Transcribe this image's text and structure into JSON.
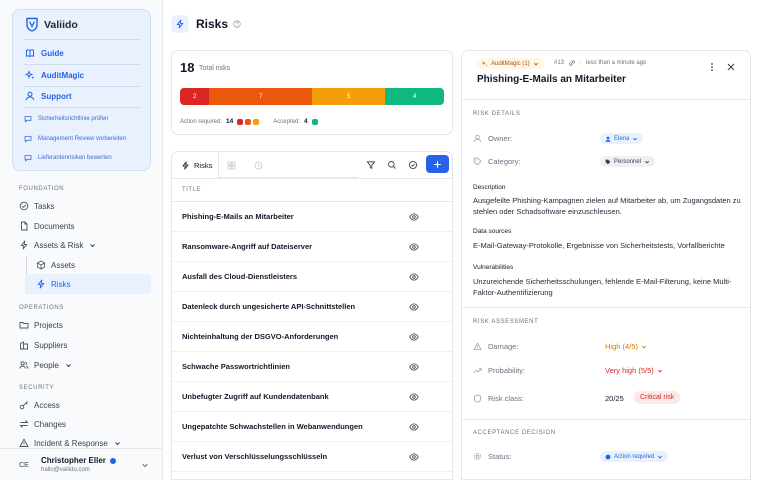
{
  "app": {
    "name": "Valiido"
  },
  "sidebar": {
    "primary": [
      {
        "label": "Guide",
        "icon": "guide-book-icon"
      },
      {
        "label": "AuditMagic",
        "icon": "sparkles-icon"
      },
      {
        "label": "Support",
        "icon": "user-support-icon"
      }
    ],
    "tasks": [
      "Sicherheitsrichtlinie prüfen",
      "Management Review vorbereiten",
      "Lieferantenrisiken bewerten"
    ],
    "sections": {
      "foundation": "FOUNDATION",
      "operations": "OPERATIONS",
      "security": "SECURITY"
    },
    "nav": {
      "tasks": "Tasks",
      "documents": "Documents",
      "assets_risk": "Assets & Risk",
      "assets": "Assets",
      "risks": "Risks",
      "projects": "Projects",
      "suppliers": "Suppliers",
      "people": "People",
      "access": "Access",
      "changes": "Changes",
      "incident_response": "Incident & Response"
    },
    "user": {
      "initials": "CE",
      "name": "Christopher Eller",
      "email": "hallo@valiido.com"
    }
  },
  "header": {
    "title": "Risks"
  },
  "summary": {
    "total": "18",
    "total_label": "Total risks",
    "segments": [
      {
        "value": 2,
        "color": "#dc2626"
      },
      {
        "value": 7,
        "color": "#ea580c"
      },
      {
        "value": 5,
        "color": "#f59e0b"
      },
      {
        "value": 4,
        "color": "#10b981"
      }
    ],
    "action_required_label": "Action required:",
    "action_required_count": "14",
    "accepted_label": "Accepted:",
    "accepted_count": "4"
  },
  "table": {
    "tab_label": "Risks",
    "column_title": "TITLE",
    "rows": [
      "Phishing-E-Mails an Mitarbeiter",
      "Ransomware-Angriff auf Dateiserver",
      "Ausfall des Cloud-Dienstleisters",
      "Datenleck durch ungesicherte API-Schnittstellen",
      "Nichteinhaltung der DSGVO-Anforderungen",
      "Schwache Passwortrichtlinien",
      "Unbefugter Zugriff auf Kundendatenbank",
      "Ungepatchte Schwachstellen in Webanwendungen",
      "Verlust von Verschlüsselungsschlüsseln"
    ]
  },
  "detail": {
    "tag": "AuditMagic (1)",
    "id": "#13",
    "time": "less than a minute ago",
    "title": "Phishing-E-Mails an Mitarbeiter",
    "risk_details_label": "RISK DETAILS",
    "owner_label": "Owner:",
    "owner": "Elena",
    "category_label": "Category:",
    "category": "Personnel",
    "description_label": "Description",
    "description": "Ausgefeilte Phishing-Kampagnen zielen auf Mitarbeiter ab, um Zugangsdaten zu stehlen oder Schadsoftware einzuschleusen.",
    "data_sources_label": "Data sources",
    "data_sources": "E-Mail-Gateway-Protokolle, Ergebnisse von Sicherheitstests, Vorfallberichte",
    "vulnerabilities_label": "Vulnerabilities",
    "vulnerabilities": "Unzureichende Sicherheitsschulungen, fehlende E-Mail-Filterung, keine Multi-Faktor-Authentifizierung",
    "risk_assessment_label": "RISK ASSESSMENT",
    "damage_label": "Damage:",
    "damage": "High (4/5)",
    "probability_label": "Probability:",
    "probability": "Very high (5/5)",
    "risk_class_label": "Risk class:",
    "risk_class_score": "20/25",
    "risk_class": "Critical risk",
    "acceptance_label": "ACCEPTANCE DECISION",
    "status_label": "Status:",
    "status": "Action required"
  }
}
